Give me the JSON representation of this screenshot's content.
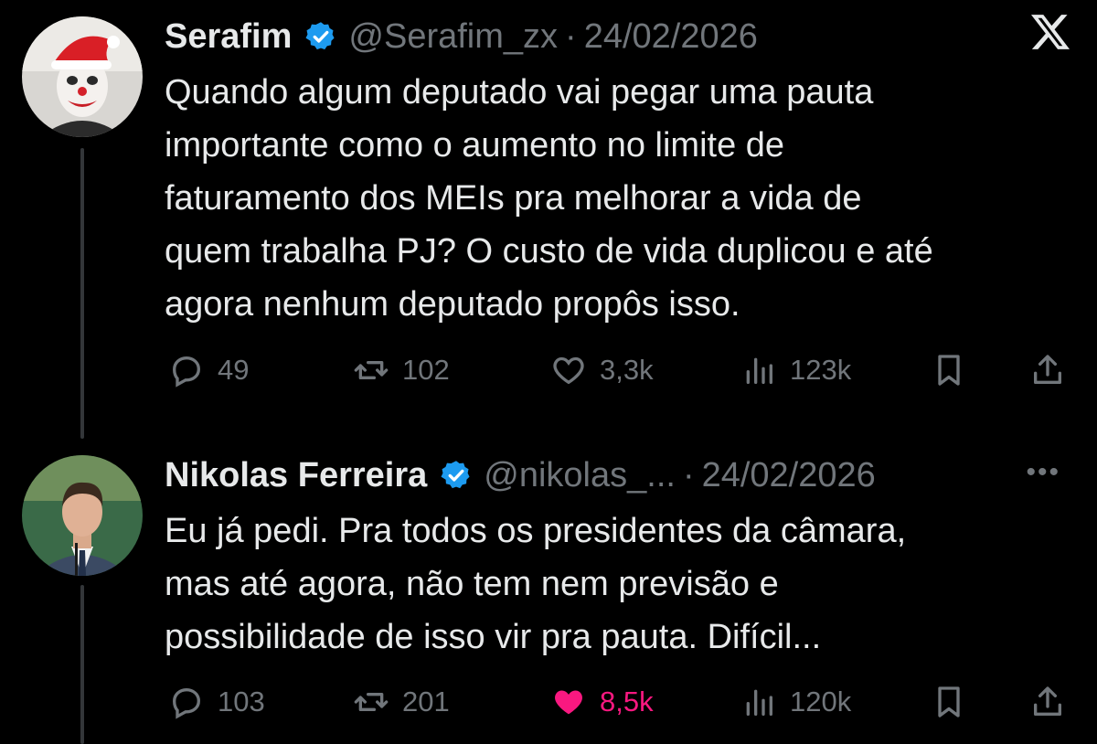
{
  "tweets": [
    {
      "name": "Serafim",
      "handle": "@Serafim_zx",
      "date": "24/02/2026",
      "lines": [
        "Quando algum deputado vai pegar uma pauta",
        "importante como o aumento no limite de",
        "faturamento dos MEIs pra melhorar a vida de",
        "quem trabalha PJ? O custo de vida duplicou e até",
        "agora nenhum deputado propôs isso."
      ],
      "replies": "49",
      "reposts": "102",
      "likes": "3,3k",
      "views": "123k",
      "liked": false
    },
    {
      "name": "Nikolas Ferreira",
      "handle": "@nikolas_...",
      "date": "24/02/2026",
      "lines": [
        "Eu já pedi. Pra todos os presidentes da câmara,",
        "mas até agora, não tem nem previsão e",
        "possibilidade de isso vir pra pauta. Difícil..."
      ],
      "replies": "103",
      "reposts": "201",
      "likes": "8,5k",
      "views": "120k",
      "liked": true
    }
  ],
  "ui": {
    "separator": "·",
    "more_label": "•••",
    "x_logo_icon": "x-logo-icon",
    "accent_like": "#f91880",
    "verified_color": "#1d9bf0"
  }
}
